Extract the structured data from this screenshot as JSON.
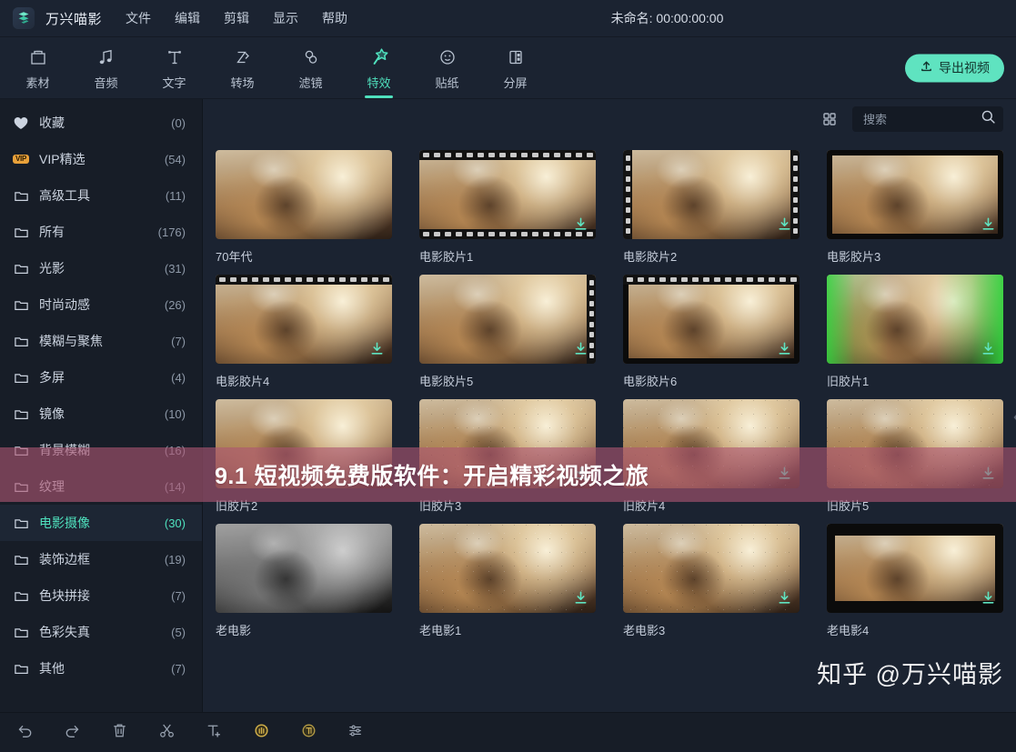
{
  "menubar": {
    "logo_icon": "wondershare-logo-icon",
    "app_name": "万兴喵影",
    "items": [
      {
        "label": "文件"
      },
      {
        "label": "编辑"
      },
      {
        "label": "剪辑"
      },
      {
        "label": "显示"
      },
      {
        "label": "帮助"
      }
    ],
    "project_title": "未命名: 00:00:00:00"
  },
  "toolbar": {
    "tabs": [
      {
        "label": "素材",
        "icon": "media-box-icon",
        "active": false
      },
      {
        "label": "音频",
        "icon": "music-note-icon",
        "active": false
      },
      {
        "label": "文字",
        "icon": "text-t-icon",
        "active": false
      },
      {
        "label": "转场",
        "icon": "transition-icon",
        "active": false
      },
      {
        "label": "滤镜",
        "icon": "filter-rings-icon",
        "active": false
      },
      {
        "label": "特效",
        "icon": "magic-wand-star-icon",
        "active": true
      },
      {
        "label": "贴纸",
        "icon": "sticker-smiley-icon",
        "active": false
      },
      {
        "label": "分屏",
        "icon": "split-screen-icon",
        "active": false
      }
    ],
    "export_label": "导出视频",
    "export_icon": "upload-icon",
    "accent_color": "#5fe3c0"
  },
  "sidebar": {
    "items": [
      {
        "label": "收藏",
        "count": "(0)",
        "icon": "heart-icon",
        "selected": false
      },
      {
        "label": "VIP精选",
        "count": "(54)",
        "icon": "vip-badge",
        "selected": false
      },
      {
        "label": "高级工具",
        "count": "(11)",
        "icon": "folder-icon",
        "selected": false
      },
      {
        "label": "所有",
        "count": "(176)",
        "icon": "folder-icon",
        "selected": false
      },
      {
        "label": "光影",
        "count": "(31)",
        "icon": "folder-icon",
        "selected": false
      },
      {
        "label": "时尚动感",
        "count": "(26)",
        "icon": "folder-icon",
        "selected": false
      },
      {
        "label": "模糊与聚焦",
        "count": "(7)",
        "icon": "folder-icon",
        "selected": false
      },
      {
        "label": "多屏",
        "count": "(4)",
        "icon": "folder-icon",
        "selected": false
      },
      {
        "label": "镜像",
        "count": "(10)",
        "icon": "folder-icon",
        "selected": false
      },
      {
        "label": "背景模糊",
        "count": "(16)",
        "icon": "folder-icon",
        "selected": false
      },
      {
        "label": "纹理",
        "count": "(14)",
        "icon": "folder-icon",
        "selected": false
      },
      {
        "label": "电影摄像",
        "count": "(30)",
        "icon": "folder-icon",
        "selected": true
      },
      {
        "label": "装饰边框",
        "count": "(19)",
        "icon": "folder-icon",
        "selected": false
      },
      {
        "label": "色块拼接",
        "count": "(7)",
        "icon": "folder-icon",
        "selected": false
      },
      {
        "label": "色彩失真",
        "count": "(5)",
        "icon": "folder-icon",
        "selected": false
      },
      {
        "label": "其他",
        "count": "(7)",
        "icon": "folder-icon",
        "selected": false
      }
    ],
    "vip_badge_text": "VIP",
    "collapse_icon": "collapse-left-arrow-icon"
  },
  "content": {
    "grid_view_icon": "grid-view-icon",
    "search": {
      "placeholder": "搜索",
      "value": "",
      "icon": "search-icon"
    },
    "effects": [
      {
        "label": "70年代",
        "style": "plain",
        "downloadable": false
      },
      {
        "label": "电影胶片1",
        "style": "film-hv",
        "downloadable": true
      },
      {
        "label": "电影胶片2",
        "style": "film-v",
        "downloadable": true
      },
      {
        "label": "电影胶片3",
        "style": "frame",
        "downloadable": true
      },
      {
        "label": "电影胶片4",
        "style": "film-h",
        "downloadable": true
      },
      {
        "label": "电影胶片5",
        "style": "film-v2",
        "downloadable": true
      },
      {
        "label": "电影胶片6",
        "style": "frame2",
        "downloadable": true
      },
      {
        "label": "旧胶片1",
        "style": "green",
        "downloadable": true
      },
      {
        "label": "旧胶片2",
        "style": "plain",
        "downloadable": false
      },
      {
        "label": "旧胶片3",
        "style": "grain",
        "downloadable": true
      },
      {
        "label": "旧胶片4",
        "style": "grain",
        "downloadable": true
      },
      {
        "label": "旧胶片5",
        "style": "grain",
        "downloadable": true
      },
      {
        "label": "老电影",
        "style": "bw",
        "downloadable": false
      },
      {
        "label": "老电影1",
        "style": "grain",
        "downloadable": true
      },
      {
        "label": "老电影3",
        "style": "grain",
        "downloadable": true
      },
      {
        "label": "老电影4",
        "style": "letterbox",
        "downloadable": true
      }
    ],
    "download_icon": "download-icon"
  },
  "banner": {
    "text": "9.1 短视频免费版软件：开启精彩视频之旅",
    "background_color": "#ad5673",
    "text_color": "#ffffff"
  },
  "watermark": {
    "text": "知乎 @万兴喵影"
  },
  "bottombar": {
    "buttons": [
      {
        "icon": "undo-icon"
      },
      {
        "icon": "redo-icon"
      },
      {
        "icon": "trash-icon"
      },
      {
        "icon": "scissors-split-icon"
      },
      {
        "icon": "add-text-icon"
      },
      {
        "icon": "audio-detach-icon"
      },
      {
        "icon": "speed-ramp-icon"
      },
      {
        "icon": "adjust-sliders-icon"
      }
    ]
  }
}
